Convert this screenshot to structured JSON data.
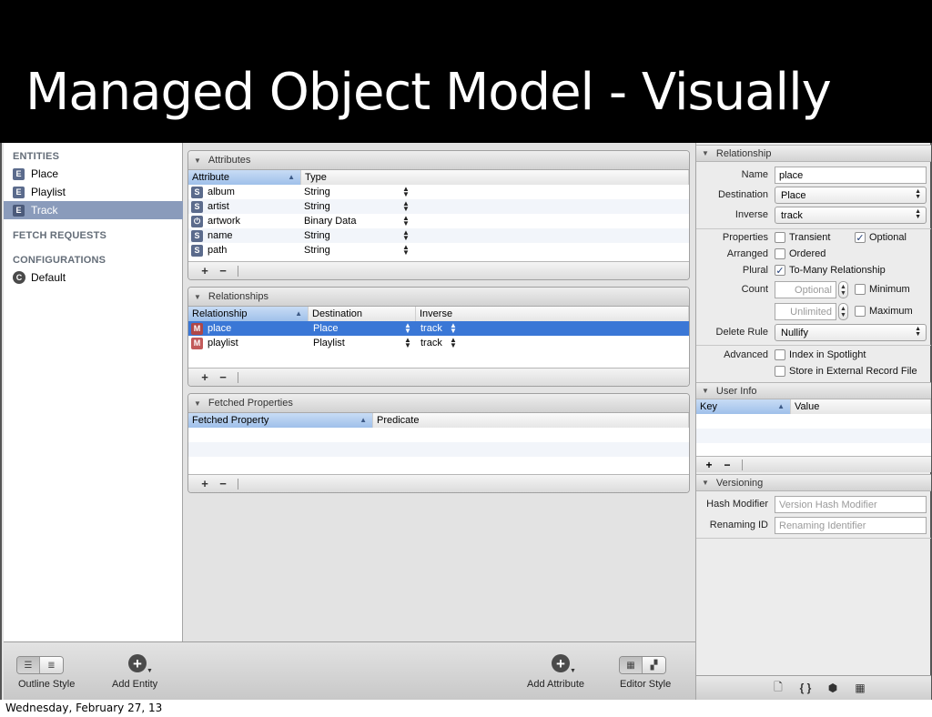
{
  "slide_title": "Managed Object Model - Visually",
  "footer_date": "Wednesday, February 27, 13",
  "sidebar": {
    "entities_heading": "ENTITIES",
    "entities": [
      {
        "badge": "E",
        "label": "Place"
      },
      {
        "badge": "E",
        "label": "Playlist"
      },
      {
        "badge": "E",
        "label": "Track",
        "selected": true
      }
    ],
    "fetch_requests_heading": "FETCH REQUESTS",
    "configurations_heading": "CONFIGURATIONS",
    "configurations": [
      {
        "badge": "C",
        "label": "Default"
      }
    ]
  },
  "attributes": {
    "title": "Attributes",
    "columns": [
      "Attribute",
      "Type"
    ],
    "rows": [
      {
        "badge": "S",
        "name": "album",
        "type": "String"
      },
      {
        "badge": "S",
        "name": "artist",
        "type": "String"
      },
      {
        "badge": "⏻",
        "name": "artwork",
        "type": "Binary Data"
      },
      {
        "badge": "S",
        "name": "name",
        "type": "String"
      },
      {
        "badge": "S",
        "name": "path",
        "type": "String"
      }
    ]
  },
  "relationships": {
    "title": "Relationships",
    "columns": [
      "Relationship",
      "Destination",
      "Inverse"
    ],
    "rows": [
      {
        "badge": "M",
        "name": "place",
        "destination": "Place",
        "inverse": "track",
        "selected": true
      },
      {
        "badge": "M",
        "name": "playlist",
        "destination": "Playlist",
        "inverse": "track"
      }
    ]
  },
  "fetched_properties": {
    "title": "Fetched Properties",
    "columns": [
      "Fetched Property",
      "Predicate"
    ]
  },
  "footer_buttons": {
    "add": "+",
    "remove": "−"
  },
  "inspector": {
    "relationship_heading": "Relationship",
    "name_label": "Name",
    "name_value": "place",
    "destination_label": "Destination",
    "destination_value": "Place",
    "inverse_label": "Inverse",
    "inverse_value": "track",
    "properties_label": "Properties",
    "transient_label": "Transient",
    "transient_checked": false,
    "optional_label": "Optional",
    "optional_checked": true,
    "arranged_label": "Arranged",
    "ordered_label": "Ordered",
    "ordered_checked": false,
    "plural_label": "Plural",
    "to_many_label": "To-Many Relationship",
    "to_many_checked": true,
    "count_label": "Count",
    "count_min_placeholder": "Optional",
    "minimum_label": "Minimum",
    "count_max_placeholder": "Unlimited",
    "maximum_label": "Maximum",
    "delete_rule_label": "Delete Rule",
    "delete_rule_value": "Nullify",
    "advanced_label": "Advanced",
    "index_spotlight_label": "Index in Spotlight",
    "external_record_label": "Store in External Record File",
    "user_info_heading": "User Info",
    "user_info_columns": [
      "Key",
      "Value"
    ],
    "versioning_heading": "Versioning",
    "hash_modifier_label": "Hash Modifier",
    "hash_modifier_placeholder": "Version Hash Modifier",
    "renaming_id_label": "Renaming ID",
    "renaming_id_placeholder": "Renaming Identifier"
  },
  "toolbar": {
    "outline_style_label": "Outline Style",
    "add_entity_label": "Add Entity",
    "add_attribute_label": "Add Attribute",
    "editor_style_label": "Editor Style"
  },
  "inspector_tabs": [
    "file-icon",
    "braces-icon",
    "cube-icon",
    "grid-icon"
  ]
}
